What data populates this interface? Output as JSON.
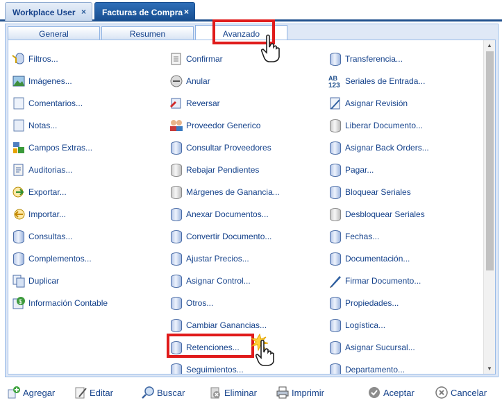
{
  "window_tabs": [
    {
      "label": "Workplace User",
      "close": "×"
    },
    {
      "label": "Facturas de Compra",
      "close": "×"
    }
  ],
  "panel_tabs": [
    "General",
    "Resumen",
    "Avanzado"
  ],
  "columns": [
    [
      {
        "label": "Filtros...",
        "icon": "filter-icon"
      },
      {
        "label": "Imágenes...",
        "icon": "image-icon"
      },
      {
        "label": "Comentarios...",
        "icon": "comment-icon"
      },
      {
        "label": "Notas...",
        "icon": "note-icon"
      },
      {
        "label": "Campos Extras...",
        "icon": "extra-fields-icon"
      },
      {
        "label": "Auditorias...",
        "icon": "audit-icon"
      },
      {
        "label": "Exportar...",
        "icon": "export-icon"
      },
      {
        "label": "Importar...",
        "icon": "import-icon"
      },
      {
        "label": "Consultas...",
        "icon": "database-icon"
      },
      {
        "label": "Complementos...",
        "icon": "database-icon"
      },
      {
        "label": "Duplicar",
        "icon": "duplicate-icon"
      },
      {
        "label": "Información Contable",
        "icon": "accounting-icon"
      }
    ],
    [
      {
        "label": "Confirmar",
        "icon": "confirm-icon"
      },
      {
        "label": "Anular",
        "icon": "void-icon"
      },
      {
        "label": "Reversar",
        "icon": "reverse-icon"
      },
      {
        "label": "Proveedor Generico",
        "icon": "users-icon"
      },
      {
        "label": "Consultar Proveedores",
        "icon": "database-icon"
      },
      {
        "label": "Rebajar Pendientes",
        "icon": "database-grey-icon"
      },
      {
        "label": "Márgenes de Ganancia...",
        "icon": "database-grey-icon"
      },
      {
        "label": "Anexar Documentos...",
        "icon": "database-icon"
      },
      {
        "label": "Convertir Documento...",
        "icon": "database-icon"
      },
      {
        "label": "Ajustar Precios...",
        "icon": "database-icon"
      },
      {
        "label": "Asignar Control...",
        "icon": "database-icon"
      },
      {
        "label": "Otros...",
        "icon": "database-icon"
      },
      {
        "label": "Cambiar Ganancias...",
        "icon": "database-icon"
      },
      {
        "label": "Retenciones...",
        "icon": "database-icon"
      },
      {
        "label": "Seguimientos...",
        "icon": "database-icon"
      }
    ],
    [
      {
        "label": "Transferencia...",
        "icon": "database-icon"
      },
      {
        "label": "Seriales de Entrada...",
        "icon": "serials-icon"
      },
      {
        "label": "Asignar Revisión",
        "icon": "review-icon"
      },
      {
        "label": "Liberar Documento...",
        "icon": "database-grey-icon"
      },
      {
        "label": "Asignar Back Orders...",
        "icon": "database-icon"
      },
      {
        "label": "Pagar...",
        "icon": "database-icon"
      },
      {
        "label": "Bloquear Seriales",
        "icon": "database-icon"
      },
      {
        "label": "Desbloquear Seriales",
        "icon": "database-grey-icon"
      },
      {
        "label": "Fechas...",
        "icon": "database-icon"
      },
      {
        "label": "Documentación...",
        "icon": "database-icon"
      },
      {
        "label": "Firmar Documento...",
        "icon": "pen-icon"
      },
      {
        "label": "Propiedades...",
        "icon": "database-icon"
      },
      {
        "label": "Logística...",
        "icon": "database-icon"
      },
      {
        "label": "Asignar Sucursal...",
        "icon": "database-icon"
      },
      {
        "label": "Departamento...",
        "icon": "database-icon"
      }
    ]
  ],
  "toolbar": {
    "agregar": "Agregar",
    "editar": "Editar",
    "buscar": "Buscar",
    "eliminar": "Eliminar",
    "imprimir": "Imprimir",
    "aceptar": "Aceptar",
    "cancelar": "Cancelar"
  },
  "serials_icon_text": [
    "AB",
    "123"
  ]
}
